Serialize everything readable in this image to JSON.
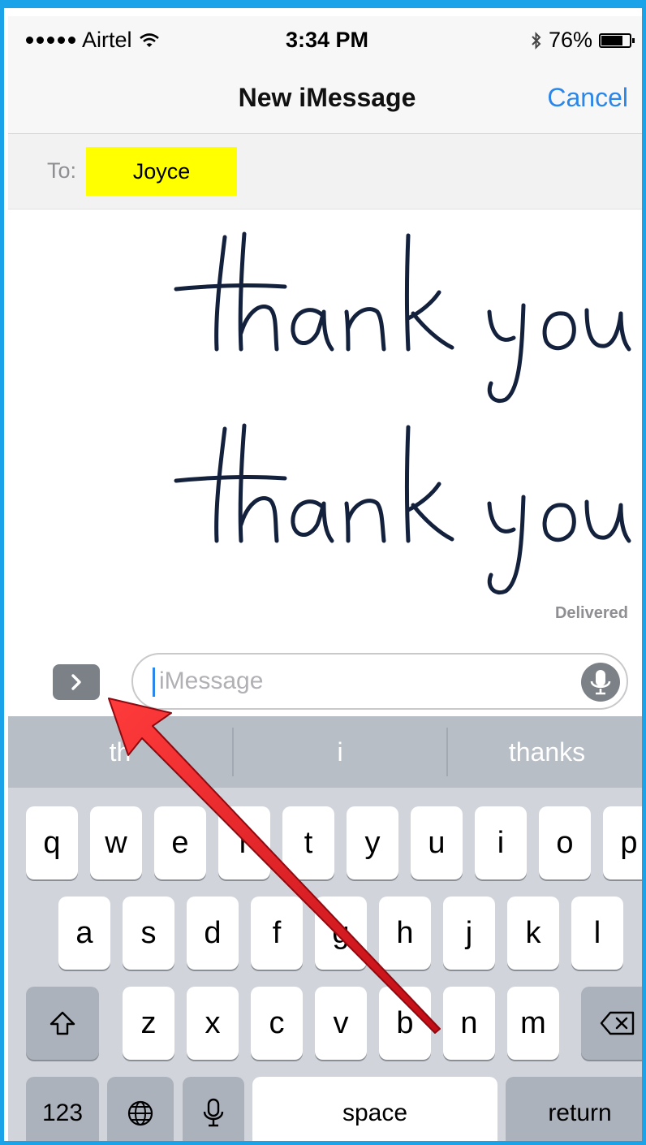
{
  "status_bar": {
    "carrier": "Airtel",
    "time": "3:34 PM",
    "battery_text": "76%",
    "battery_level": 0.76,
    "icons": [
      "signal-dots-icon",
      "wifi-icon",
      "bluetooth-icon",
      "battery-icon"
    ]
  },
  "nav": {
    "title": "New iMessage",
    "cancel_label": "Cancel"
  },
  "recipient": {
    "to_label": "To:",
    "name": "Joyce",
    "highlight_color": "#ffff00"
  },
  "messages": [
    {
      "type": "handwriting",
      "text": "thank you"
    },
    {
      "type": "handwriting",
      "text": "thank you"
    }
  ],
  "delivery_status": "Delivered",
  "compose": {
    "expand_icon": "chevron-right-icon",
    "placeholder": "iMessage",
    "mic_icon": "microphone-icon"
  },
  "predictions": [
    "th",
    "i",
    "thanks"
  ],
  "keyboard": {
    "row1": [
      "q",
      "w",
      "e",
      "r",
      "t",
      "y",
      "u",
      "i",
      "o",
      "p"
    ],
    "row2": [
      "a",
      "s",
      "d",
      "f",
      "g",
      "h",
      "j",
      "k",
      "l"
    ],
    "row3": [
      "z",
      "x",
      "c",
      "v",
      "b",
      "n",
      "m"
    ],
    "numbers_label": "123",
    "space_label": "space",
    "return_label": "return"
  },
  "annotation": {
    "type": "arrow",
    "color": "#d9141c",
    "points_to": "expand-button"
  }
}
